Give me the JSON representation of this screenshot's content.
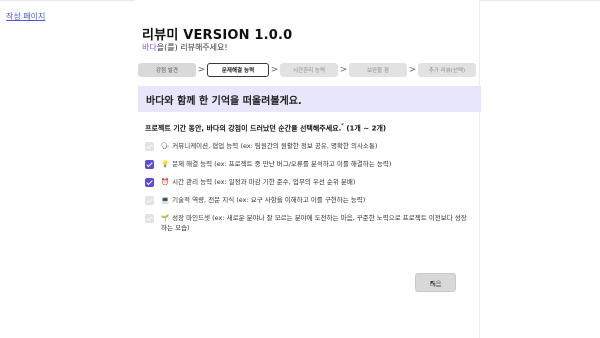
{
  "back_link": "작성 페이지",
  "header": {
    "title": "리뷰미 VERSION 1.0.0",
    "subtitle_name": "바다",
    "subtitle_rest": "을(를) 리뷰해주세요!"
  },
  "steps": [
    {
      "label": "강점 발견",
      "state": "done"
    },
    {
      "label": "문제해결 능력",
      "state": "current"
    },
    {
      "label": "시간관리 능력",
      "state": "todo"
    },
    {
      "label": "보완할 점",
      "state": "todo"
    },
    {
      "label": "추가 리뷰(선택)",
      "state": "todo"
    }
  ],
  "step_arrow": ">",
  "banner": "바다와 함께 한 기억을 떠올려볼게요.",
  "question": {
    "text": "프로젝트 기간 동안, 바다의 강점이 드러났던 순간을 선택해주세요.",
    "required_mark": "*",
    "range": "(1개 ~ 2개)"
  },
  "options": [
    {
      "icon": "🗣",
      "label": "커뮤니케이션, 협업 능력 (ex: 팀원간의 원활한 정보 공유, 명확한 의사소통)",
      "checked": false
    },
    {
      "icon": "💡",
      "label": "문제 해결 능력 (ex: 프로젝트 중 만난 버그/오류를 분석하고 이를 해결하는 능력)",
      "checked": true
    },
    {
      "icon": "⏰",
      "label": "시간 관리 능력 (ex: 일정과 마감 기한 준수, 업무의 우선 순위 분배)",
      "checked": true
    },
    {
      "icon": "💻",
      "label": "기술적 역량, 전문 지식 (ex: 요구 사항을 이해하고 이를 구현하는 능력)",
      "checked": false
    },
    {
      "icon": "🌱",
      "label": "성장 마인드셋 (ex: 새로운 분야나 잘 모르는 분야에 도전하는 마음, 꾸준한 노력으로 프로젝트 이전보다 성장하는 모습)",
      "checked": false
    }
  ],
  "next_button": "다음",
  "colors": {
    "accent": "#5b4cd6",
    "banner_bg": "#e8e6fb",
    "name_highlight": "#8b5cf6"
  }
}
